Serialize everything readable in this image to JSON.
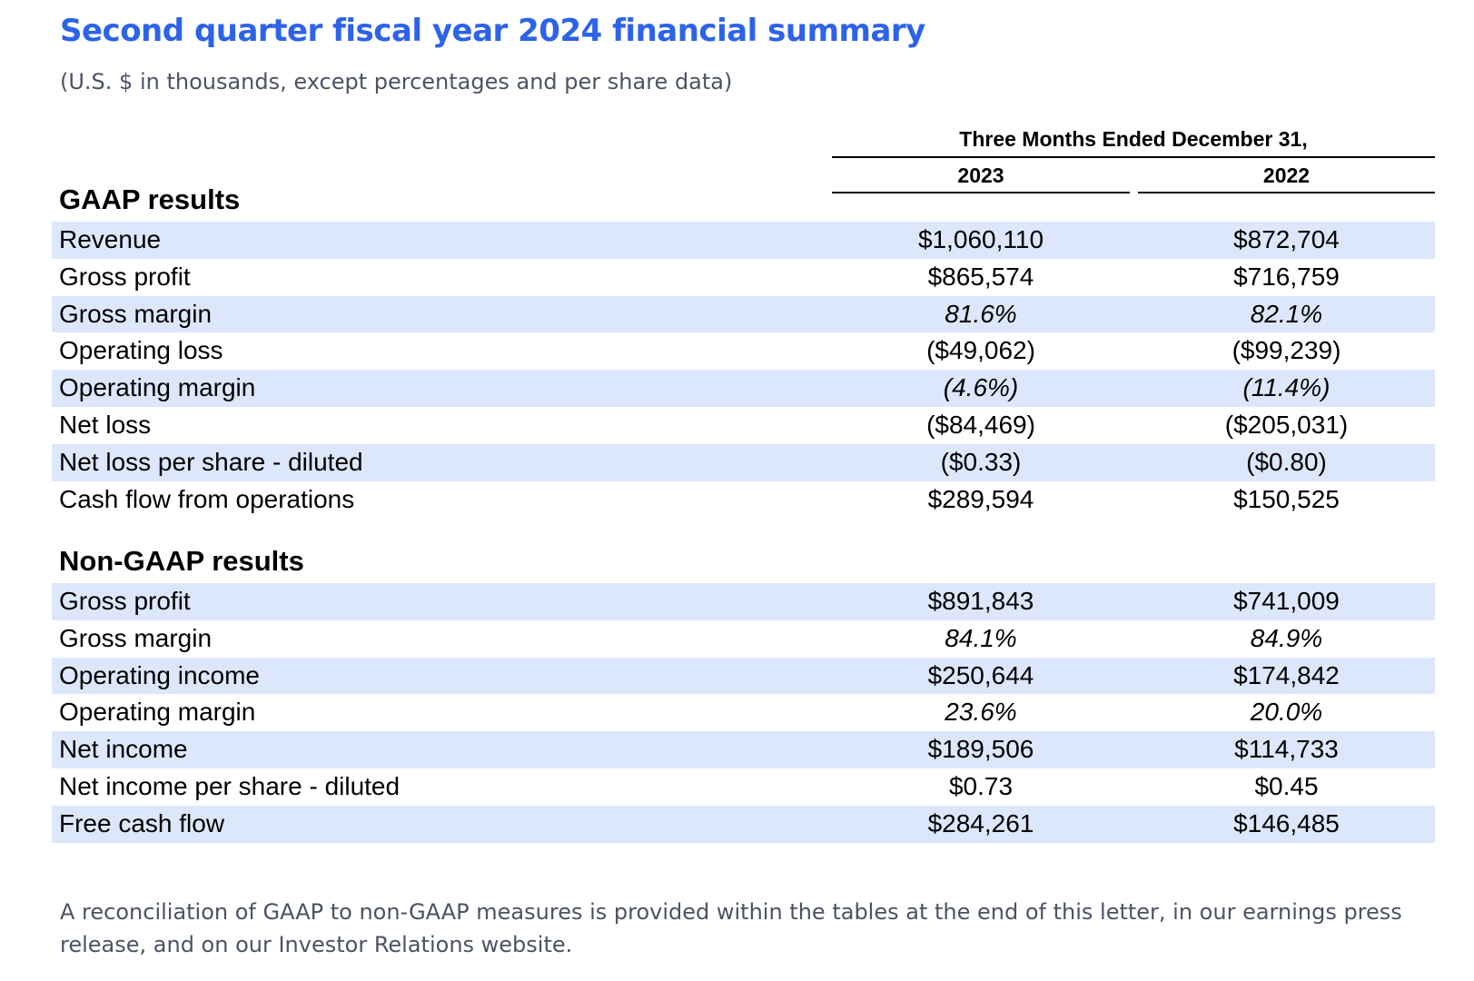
{
  "header": {
    "title": "Second quarter fiscal year 2024 financial summary",
    "subtitle": "(U.S. $ in thousands, except percentages and per share data)"
  },
  "table": {
    "period_header": "Three Months Ended December 31,",
    "columns": [
      "2023",
      "2022"
    ],
    "shade_color": "#dde7fb",
    "sections": [
      {
        "title": "GAAP results",
        "rows": [
          {
            "label": "Revenue",
            "values": [
              "$1,060,110",
              "$872,704"
            ],
            "italic": false
          },
          {
            "label": "Gross profit",
            "values": [
              "$865,574",
              "$716,759"
            ],
            "italic": false
          },
          {
            "label": "Gross margin",
            "values": [
              "81.6%",
              "82.1%"
            ],
            "italic": true
          },
          {
            "label": "Operating loss",
            "values": [
              "($49,062)",
              "($99,239)"
            ],
            "italic": false
          },
          {
            "label": "Operating margin",
            "values": [
              "(4.6%)",
              "(11.4%)"
            ],
            "italic": true
          },
          {
            "label": "Net loss",
            "values": [
              "($84,469)",
              "($205,031)"
            ],
            "italic": false
          },
          {
            "label": "Net loss per share - diluted",
            "values": [
              "($0.33)",
              "($0.80)"
            ],
            "italic": false
          },
          {
            "label": "Cash flow from operations",
            "values": [
              "$289,594",
              "$150,525"
            ],
            "italic": false
          }
        ]
      },
      {
        "title": "Non-GAAP results",
        "rows": [
          {
            "label": "Gross profit",
            "values": [
              "$891,843",
              "$741,009"
            ],
            "italic": false
          },
          {
            "label": "Gross margin",
            "values": [
              "84.1%",
              "84.9%"
            ],
            "italic": true
          },
          {
            "label": "Operating income",
            "values": [
              "$250,644",
              "$174,842"
            ],
            "italic": false
          },
          {
            "label": "Operating margin",
            "values": [
              "23.6%",
              "20.0%"
            ],
            "italic": true
          },
          {
            "label": "Net income",
            "values": [
              "$189,506",
              "$114,733"
            ],
            "italic": false
          },
          {
            "label": "Net income per share - diluted",
            "values": [
              "$0.73",
              "$0.45"
            ],
            "italic": false
          },
          {
            "label": "Free cash flow",
            "values": [
              "$284,261",
              "$146,485"
            ],
            "italic": false
          }
        ]
      }
    ]
  },
  "footnote": "A reconciliation of GAAP to non-GAAP measures is provided within the tables at the end of this letter, in our earnings press release, and on our Investor Relations website."
}
